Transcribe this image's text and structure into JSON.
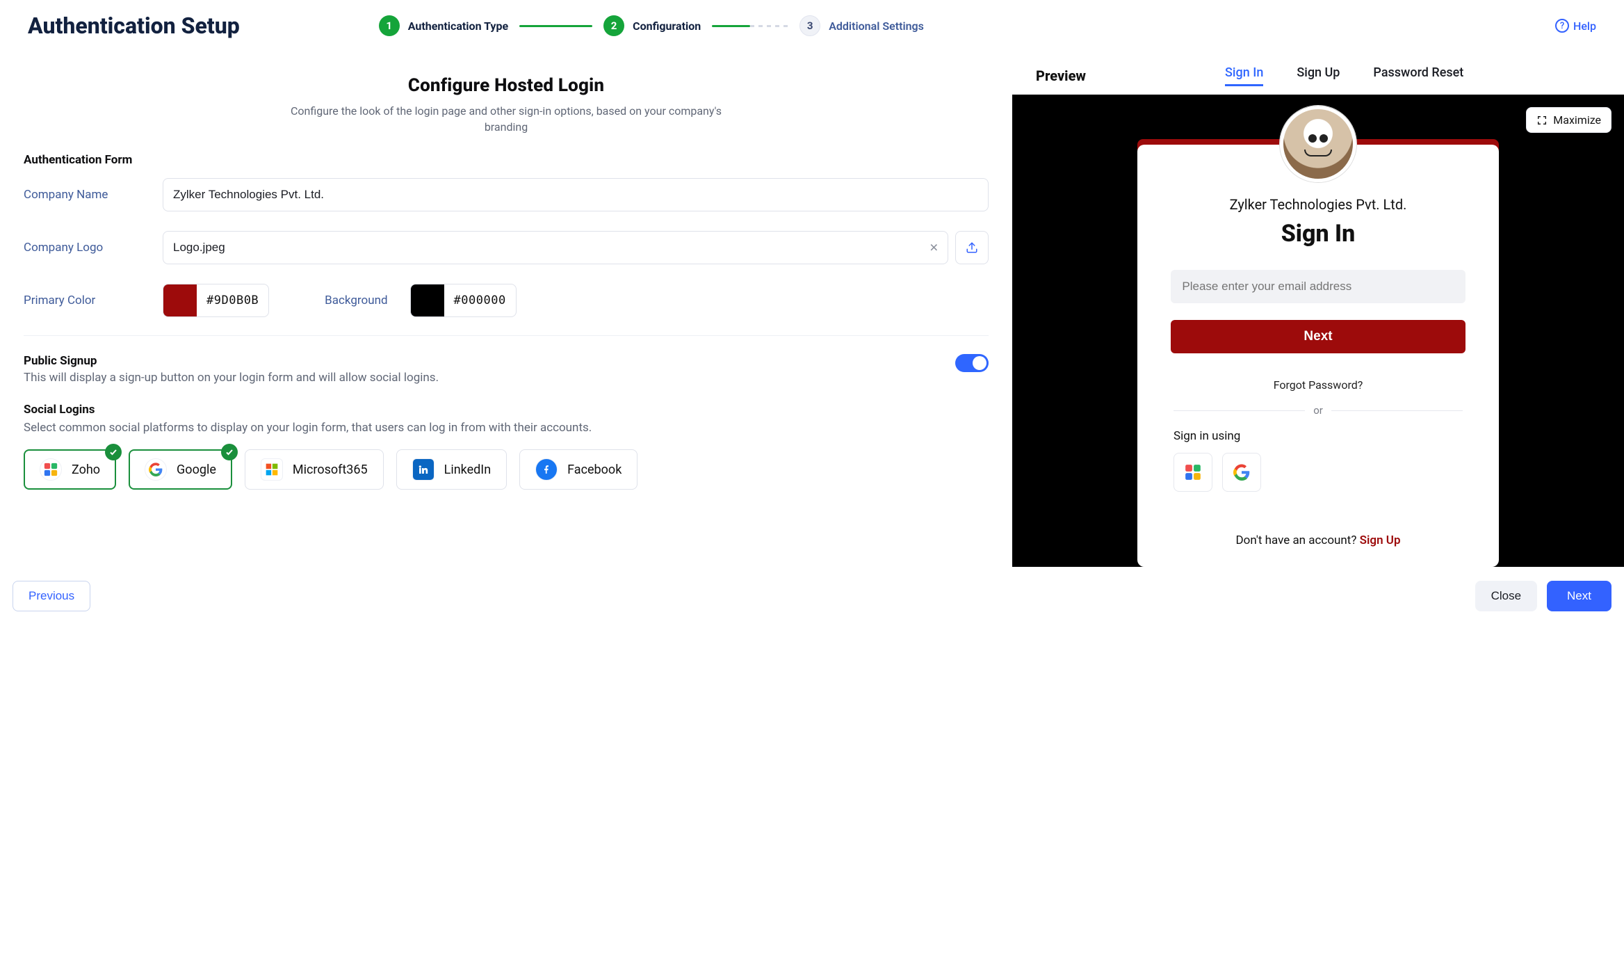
{
  "colors": {
    "accent": "#3362ff",
    "primary": "#9D0B0B",
    "background_hex": "#000000",
    "step_done": "#15a43a"
  },
  "header": {
    "title": "Authentication Setup",
    "help": "Help",
    "steps": [
      {
        "num": "1",
        "label": "Authentication Type"
      },
      {
        "num": "2",
        "label": "Configuration"
      },
      {
        "num": "3",
        "label": "Additional Settings"
      }
    ]
  },
  "config": {
    "title": "Configure Hosted Login",
    "subtitle": "Configure the look of the login page and other sign-in options, based on your company's branding",
    "section_auth_form": "Authentication Form",
    "labels": {
      "company_name": "Company Name",
      "company_logo": "Company Logo",
      "primary_color": "Primary Color",
      "background": "Background"
    },
    "values": {
      "company_name": "Zylker Technologies Pvt. Ltd.",
      "logo_filename": "Logo.jpeg",
      "primary_color_text": "9D0B0B",
      "background_color_text": "000000"
    },
    "public_signup": {
      "title": "Public Signup",
      "desc": "This will display a sign-up button on your login form and will allow social logins.",
      "enabled": true
    },
    "social_logins": {
      "title": "Social Logins",
      "desc": "Select common social platforms to display on your login form, that users can log in from with their accounts.",
      "options": [
        {
          "id": "zoho",
          "label": "Zoho",
          "selected": true
        },
        {
          "id": "google",
          "label": "Google",
          "selected": true
        },
        {
          "id": "microsoft365",
          "label": "Microsoft365",
          "selected": false
        },
        {
          "id": "linkedin",
          "label": "LinkedIn",
          "selected": false
        },
        {
          "id": "facebook",
          "label": "Facebook",
          "selected": false
        }
      ]
    }
  },
  "preview": {
    "title": "Preview",
    "tabs": {
      "signin": "Sign In",
      "signup": "Sign Up",
      "pwreset": "Password Reset"
    },
    "active_tab": "signin",
    "maximize": "Maximize",
    "card": {
      "company": "Zylker Technologies Pvt. Ltd.",
      "heading": "Sign In",
      "email_placeholder": "Please enter your email address",
      "next": "Next",
      "forgot": "Forgot Password?",
      "or": "or",
      "signin_using": "Sign in using",
      "cta_prefix": "Don't have an account? ",
      "cta_link": "Sign Up"
    }
  },
  "footer": {
    "previous": "Previous",
    "close": "Close",
    "next": "Next"
  }
}
